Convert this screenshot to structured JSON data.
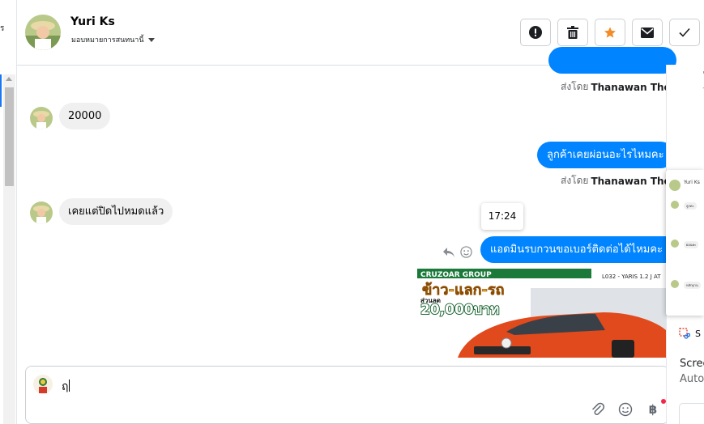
{
  "header": {
    "contact_name": "Yuri Ks",
    "assign_label": "มอบหมายการสนทนานี้",
    "actions": [
      {
        "icon": "alert-icon",
        "name": "mark-spam-button"
      },
      {
        "icon": "trash-icon",
        "name": "delete-button"
      },
      {
        "icon": "star-icon",
        "name": "star-button"
      },
      {
        "icon": "mail-icon",
        "name": "mark-unread-button"
      },
      {
        "icon": "check-icon",
        "name": "mark-done-button"
      }
    ],
    "accent_star": "#f28c28"
  },
  "left_strip": {
    "mark": "ร"
  },
  "messages": {
    "sent_by_prefix": "ส่งโดย",
    "m1": {
      "sender": "Thanawan Thon"
    },
    "m2": {
      "text": "20000"
    },
    "m3": {
      "text": "ลูกค้าเคยผ่อนอะไรไหมคะ",
      "sender": "Thanawan Thon"
    },
    "m4": {
      "text": "เคยแต่ปิดไปหมดแล้ว"
    },
    "m5": {
      "text": "แอดมินรบกวนขอเบอร์ติดต่อได้ไหมคะ",
      "time_tooltip": "17:24"
    },
    "ad": {
      "title": "CRUZOAR GROUP",
      "headline": "ข้าว-แลก-รถ",
      "discount_label": "ส่วนลด",
      "discount": "20,000บาท",
      "model": "L032 - YARIS 1.2 J AT"
    },
    "bubble_out_color": "#0084ff",
    "bubble_in_color": "#f0f0f0"
  },
  "composer": {
    "value": "ฤ"
  },
  "right_panel": {
    "snip_label": "S",
    "title": "Scree",
    "subtitle": "Auto",
    "mini_name": "Yuri Ks",
    "mini_msgs": [
      "ลูกคะ",
      "ผ่อนคะ",
      "หลักฐาน"
    ],
    "edge_marks": [
      "'",
      "?"
    ]
  }
}
